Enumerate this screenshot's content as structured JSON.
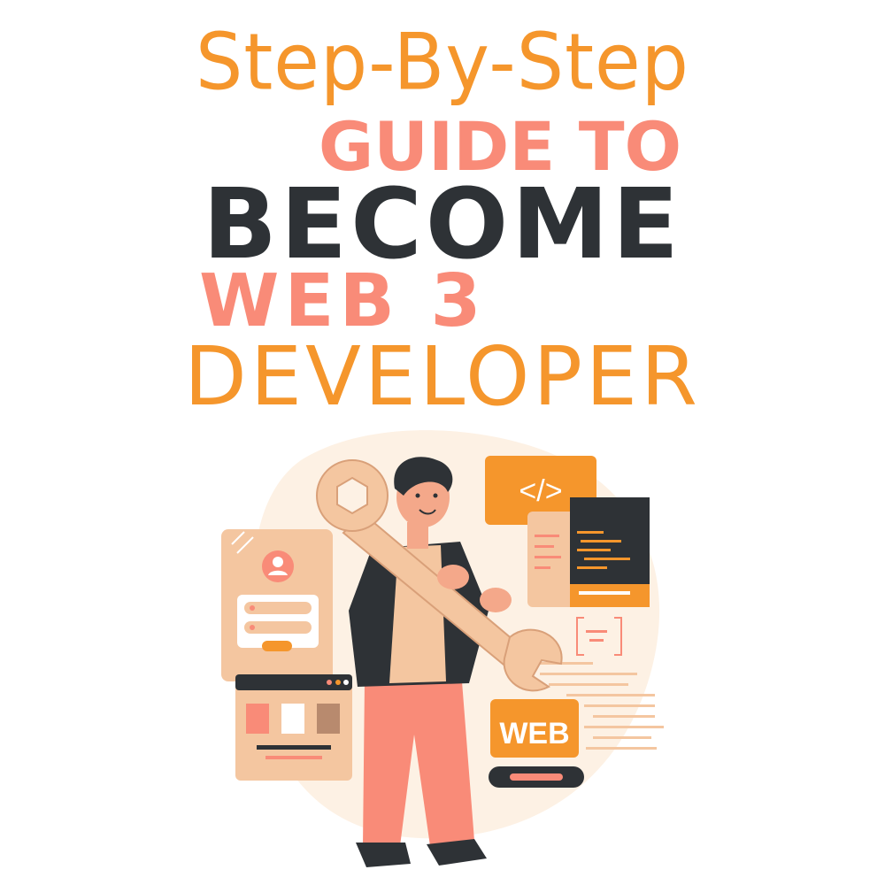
{
  "title": {
    "line1": "Step-By-Step",
    "line2": "GUIDE TO",
    "line3": "BECOME",
    "line4": "WEB 3",
    "line5": "DEVELOPER"
  },
  "illustration": {
    "code_tag_label": "</>",
    "web_badge_label": "WEB"
  },
  "colors": {
    "orange": "#f5962c",
    "salmon": "#f98b78",
    "dark": "#2e3236",
    "cream": "#fdf1e4",
    "peach": "#f4c6a0"
  }
}
